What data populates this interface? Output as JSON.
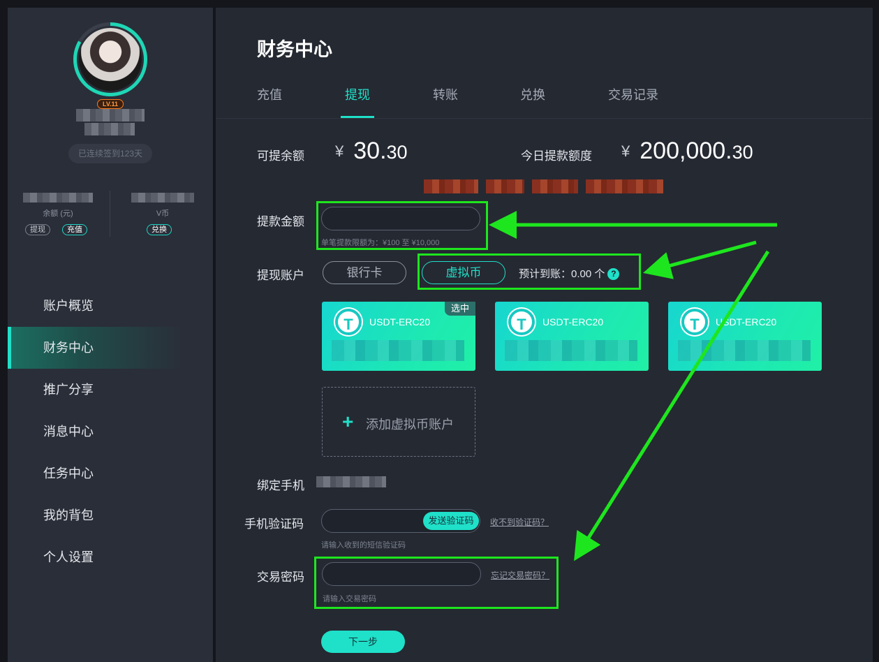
{
  "sidebar": {
    "level": "LV.11",
    "signin": "已连续签到123天",
    "balance_label": "余额 (元)",
    "vcoin_label": "V币",
    "withdraw_pill": "提现",
    "recharge_pill": "充值",
    "exchange_pill": "兑换",
    "nav": [
      "账户概览",
      "财务中心",
      "推广分享",
      "消息中心",
      "任务中心",
      "我的背包",
      "个人设置"
    ]
  },
  "page": {
    "title": "财务中心",
    "tabs": [
      "充值",
      "提现",
      "转账",
      "兑换",
      "交易记录"
    ],
    "active_tab": "提现"
  },
  "balances": {
    "available_label": "可提余额",
    "currency": "¥",
    "available_int": "30.",
    "available_dec": "30",
    "limit_label": "今日提款额度",
    "limit_int": "200,000.",
    "limit_dec": "30"
  },
  "form": {
    "amount_label": "提款金额",
    "amount_hint": "单笔提款限额为：¥100 至 ¥10,000",
    "account_label": "提现账户",
    "bank_card": "银行卡",
    "crypto": "虚拟币",
    "estimate": "预计到账：0.00 个",
    "help_icon": "?",
    "cards": [
      {
        "name": "USDT-ERC20",
        "selected": true
      },
      {
        "name": "USDT-ERC20",
        "selected": false
      },
      {
        "name": "USDT-ERC20",
        "selected": false
      }
    ],
    "selected_badge": "选中",
    "add_account": "添加虚拟币账户",
    "phone_label": "绑定手机",
    "sms_label": "手机验证码",
    "send_code": "发送验证码",
    "no_code": "收不到验证码？",
    "sms_hint": "请输入收到的短信验证码",
    "pwd_label": "交易密码",
    "forgot_pwd": "忘记交易密码？",
    "pwd_hint": "请输入交易密码",
    "next": "下一步"
  },
  "colors": {
    "accent": "#1fe0c8",
    "highlight": "#1ee61e",
    "sidebar_bg": "#2a2e38",
    "main_bg": "#252932"
  }
}
